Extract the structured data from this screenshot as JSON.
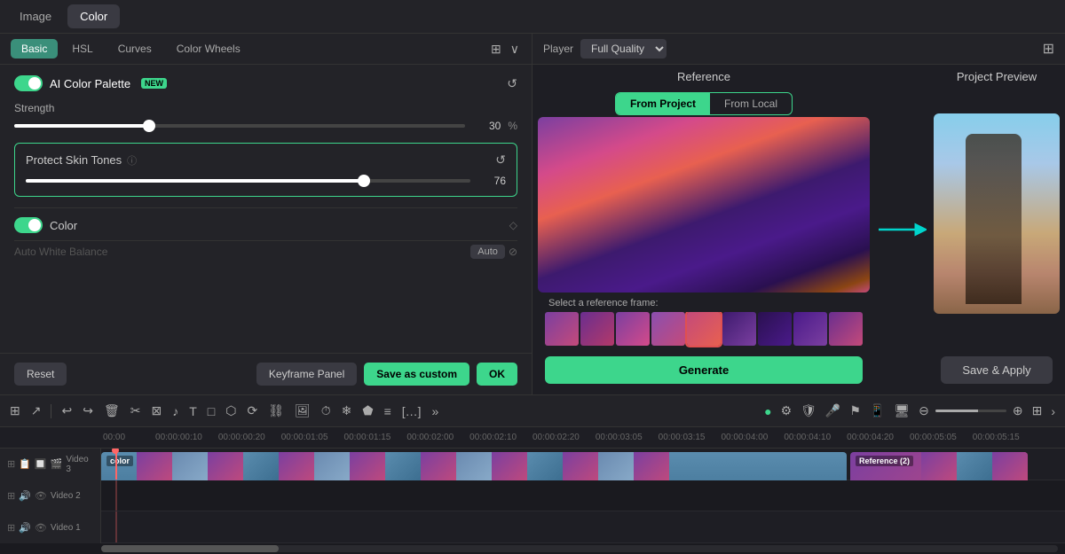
{
  "tabs": {
    "image": "Image",
    "color": "Color"
  },
  "activeTab": "color",
  "subTabs": [
    "Basic",
    "HSL",
    "Curves",
    "Color Wheels"
  ],
  "activeSubTab": "Basic",
  "aiColorPalette": {
    "label": "AI Color Palette",
    "badge": "NEW",
    "enabled": true
  },
  "strength": {
    "label": "Strength",
    "value": 30,
    "unit": "%",
    "fillPercent": 30
  },
  "protectSkinTones": {
    "label": "Protect Skin Tones",
    "value": 76,
    "fillPercent": 76
  },
  "color": {
    "label": "Color",
    "autoWhiteBalance": "Auto White Balance",
    "autoBtn": "Auto"
  },
  "footer": {
    "reset": "Reset",
    "keyframePanel": "Keyframe Panel",
    "saveAsCustom": "Save as custom",
    "ok": "OK"
  },
  "rightPanel": {
    "player": "Player",
    "quality": "Full Quality",
    "reference": "Reference",
    "projectPreview": "Project Preview",
    "fromProject": "From Project",
    "fromLocal": "From Local",
    "selectFrame": "Select a reference frame:",
    "generate": "Generate",
    "saveApply": "Save & Apply"
  },
  "timeline": {
    "rulerMarks": [
      "00:00",
      "00:00:00:10",
      "00:00:00:20",
      "00:00:01:05",
      "00:00:01:15",
      "00:00:02:00",
      "00:00:02:10",
      "00:00:02:20",
      "00:00:03:05",
      "00:00:03:15",
      "00:00:04:00",
      "00:00:04:10",
      "00:00:04:20",
      "00:00:05:05",
      "00:00:05:15"
    ],
    "tracks": [
      {
        "name": "Video 3",
        "number": 3
      },
      {
        "name": "Video 2",
        "number": 2
      },
      {
        "name": "Video 1",
        "number": 1
      }
    ],
    "colorClip": "color",
    "referenceClip": "Reference (2)"
  }
}
